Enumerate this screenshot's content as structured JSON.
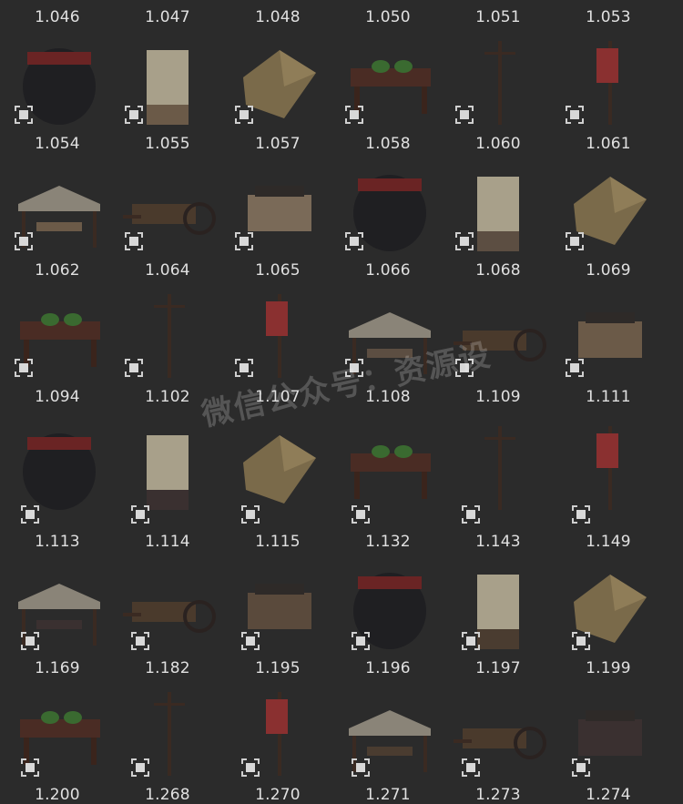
{
  "rows": [
    {
      "labels": [
        "1.046",
        "1.047",
        "1.048",
        "1.050",
        "1.051",
        "1.053"
      ],
      "labels_top": true
    },
    {
      "labels": [
        "1.054",
        "1.055",
        "1.057",
        "1.058",
        "1.060",
        "1.061"
      ]
    },
    {
      "labels": [
        "1.062",
        "1.064",
        "1.065",
        "1.066",
        "1.068",
        "1.069"
      ]
    },
    {
      "labels": [
        "1.094",
        "1.102",
        "1.107",
        "1.108",
        "1.109",
        "1.111"
      ]
    },
    {
      "labels": [
        "1.113",
        "1.114",
        "1.115",
        "1.132",
        "1.143",
        "1.149"
      ]
    },
    {
      "labels": [
        "1.169",
        "1.182",
        "1.195",
        "1.196",
        "1.197",
        "1.199"
      ]
    },
    {
      "labels": [
        "1.200",
        "1.268",
        "1.270",
        "1.271",
        "1.273",
        "1.274"
      ]
    }
  ],
  "watermark": "微信公众号：资源设",
  "colors": {
    "background": "#2b2b2b",
    "label": "#e0e0e0",
    "select_icon": "#cfcfcf"
  }
}
